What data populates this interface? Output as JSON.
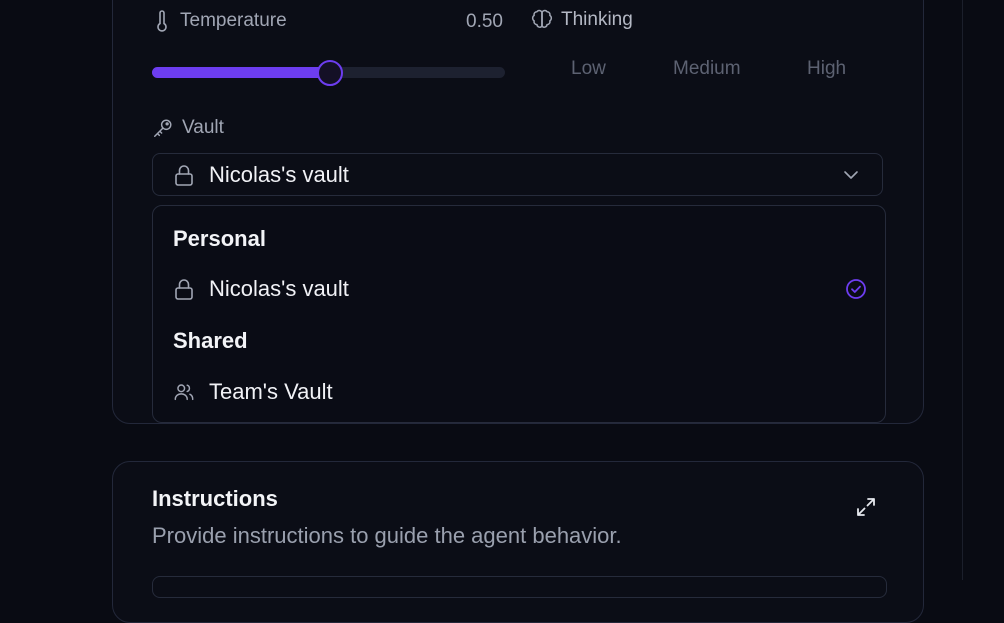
{
  "temperature": {
    "label": "Temperature",
    "value_text": "0.50",
    "value": 0.5
  },
  "thinking": {
    "label": "Thinking",
    "options": [
      "Low",
      "Medium",
      "High"
    ]
  },
  "vault": {
    "label": "Vault",
    "selected": "Nicolas's vault",
    "menu": {
      "groups": [
        {
          "title": "Personal",
          "items": [
            {
              "label": "Nicolas's vault",
              "icon": "lock-icon",
              "checked": true
            }
          ]
        },
        {
          "title": "Shared",
          "items": [
            {
              "label": "Team's Vault",
              "icon": "users-icon",
              "checked": false
            }
          ]
        }
      ]
    }
  },
  "instructions": {
    "title": "Instructions",
    "subtitle": "Provide instructions to guide the agent behavior."
  },
  "colors": {
    "accent": "#6d3df0",
    "background": "#090b13",
    "muted": "#5d6272"
  }
}
